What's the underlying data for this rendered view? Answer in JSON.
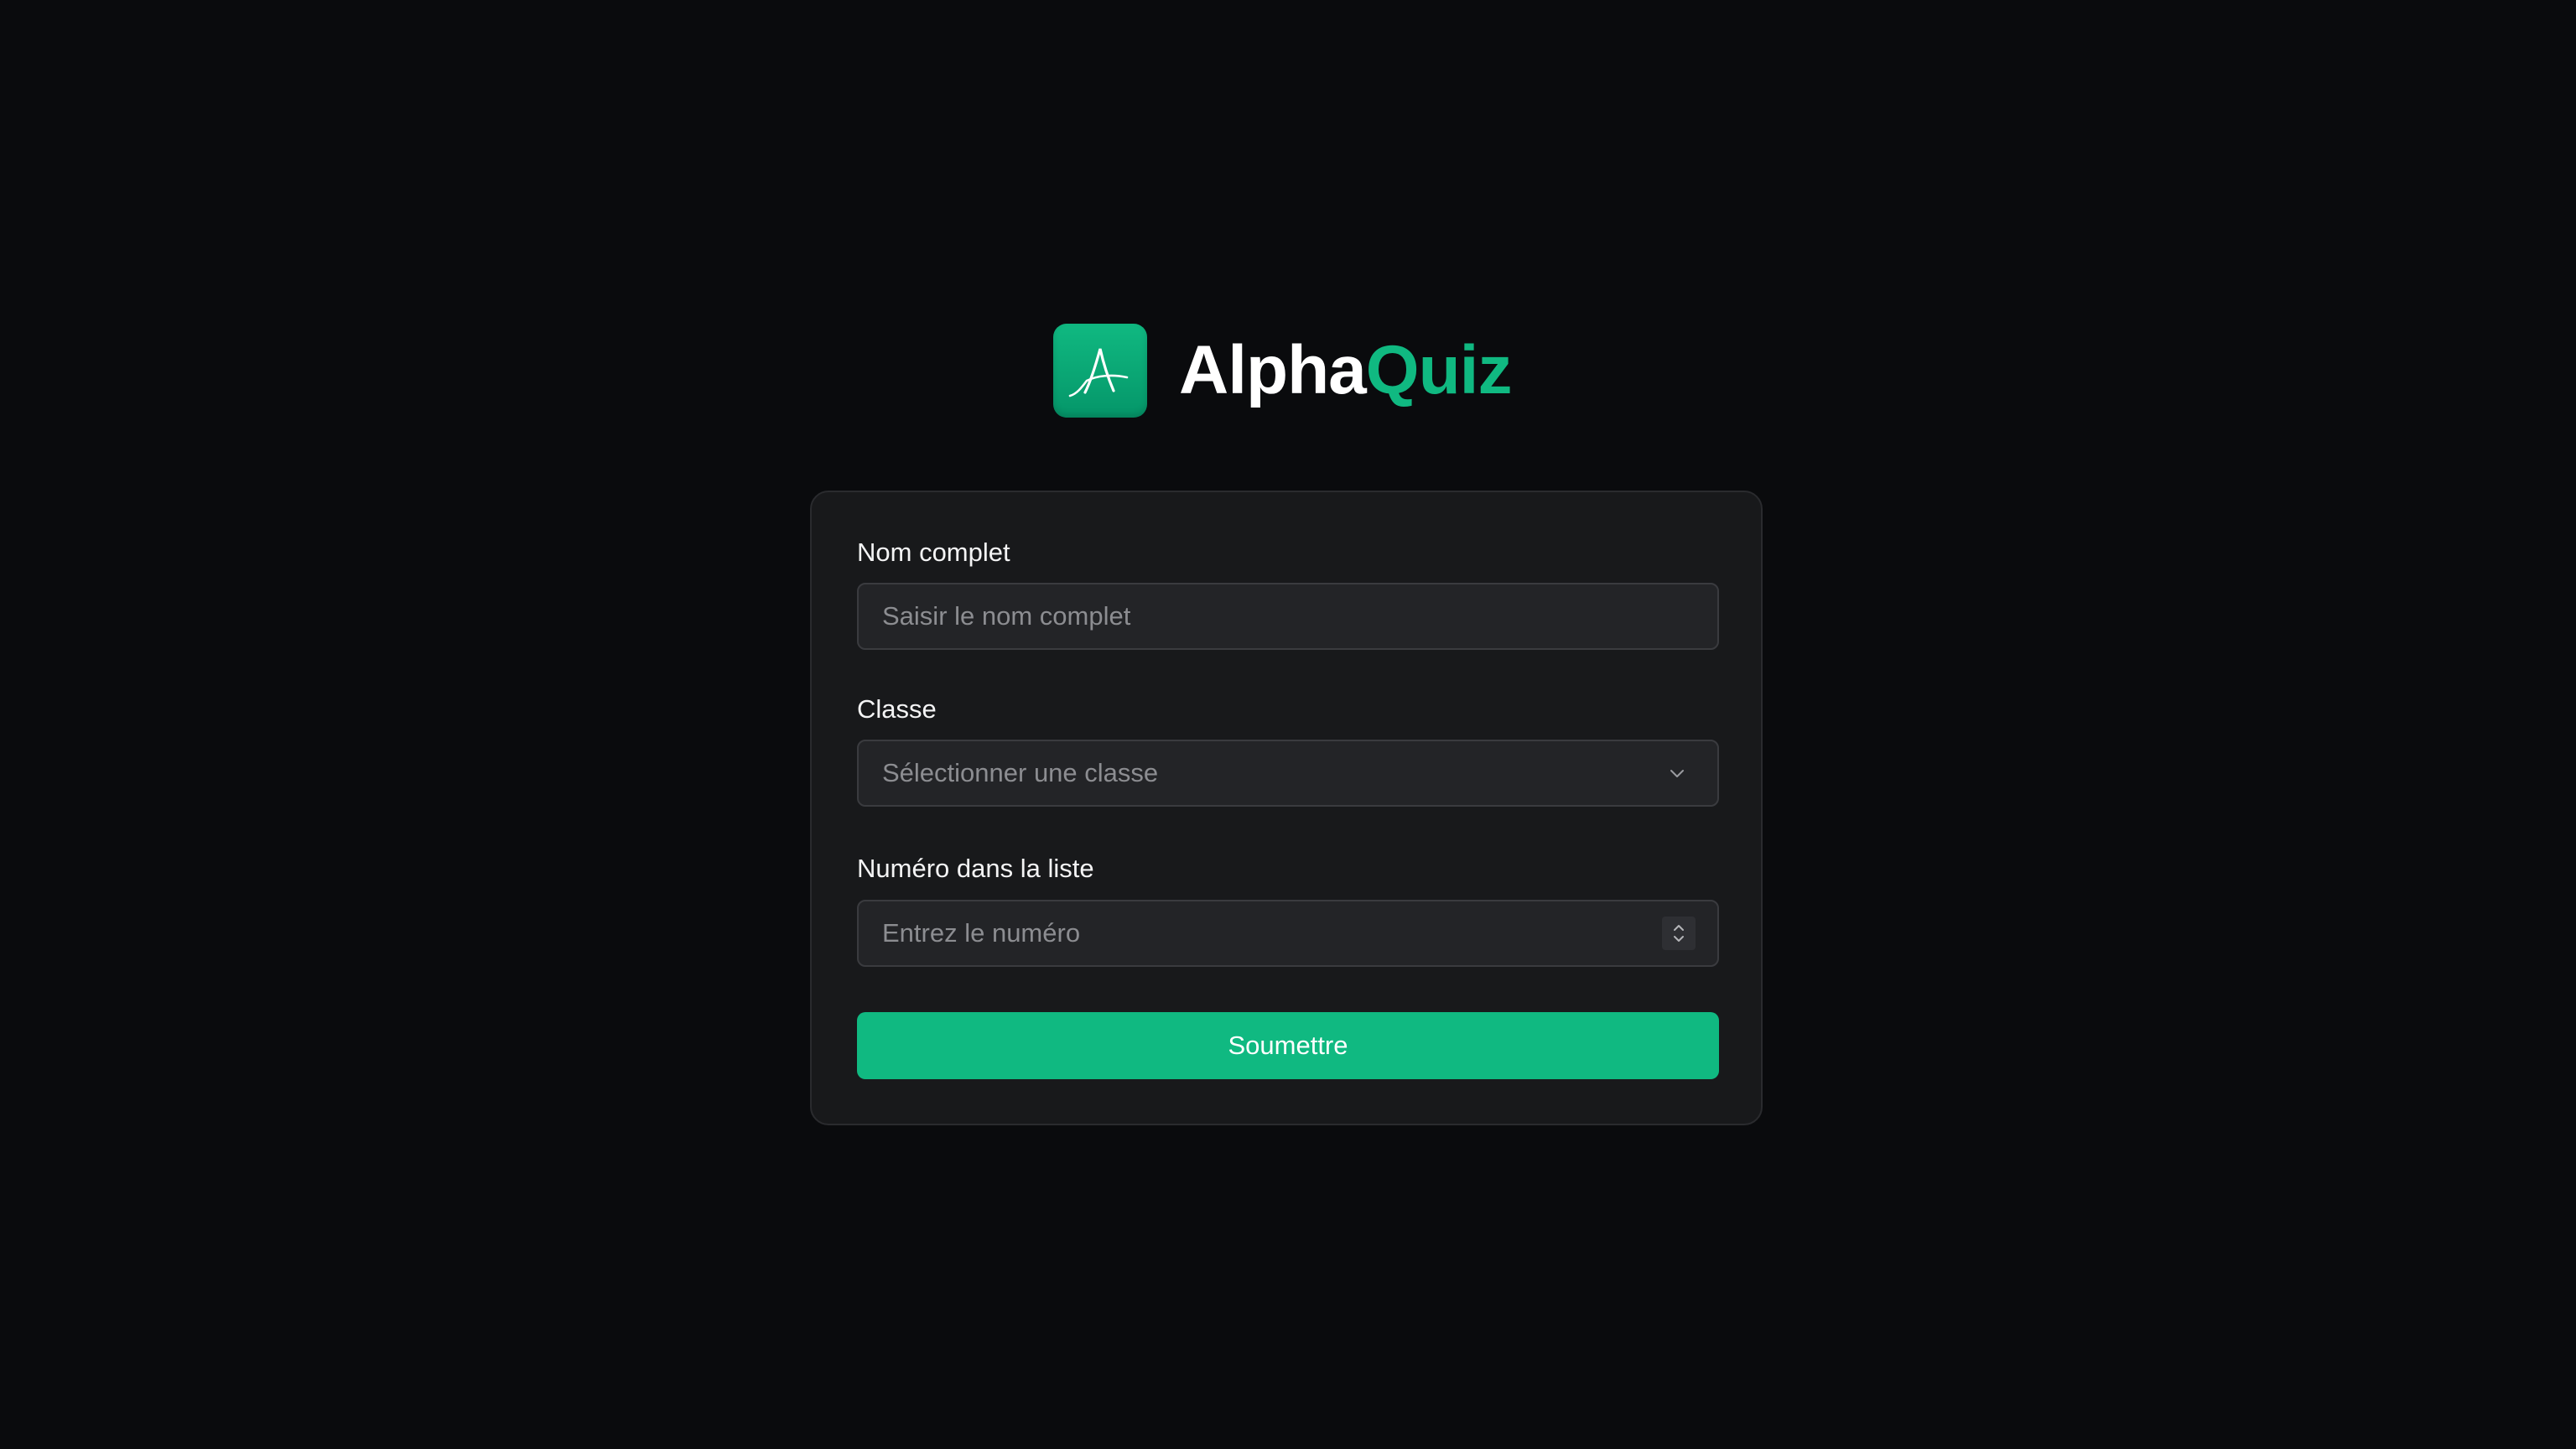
{
  "brand": {
    "name_part1": "Alpha",
    "name_part2": "Quiz",
    "logo_icon": "alpha-a-logo-icon",
    "accent_color": "#10b981"
  },
  "form": {
    "full_name": {
      "label": "Nom complet",
      "placeholder": "Saisir le nom complet",
      "value": ""
    },
    "class": {
      "label": "Classe",
      "selected": "Sélectionner une classe",
      "icon": "chevron-down-icon"
    },
    "list_number": {
      "label": "Numéro dans la liste",
      "placeholder": "Entrez le numéro",
      "value": "",
      "icon": "number-stepper-icon"
    },
    "submit_label": "Soumettre"
  }
}
